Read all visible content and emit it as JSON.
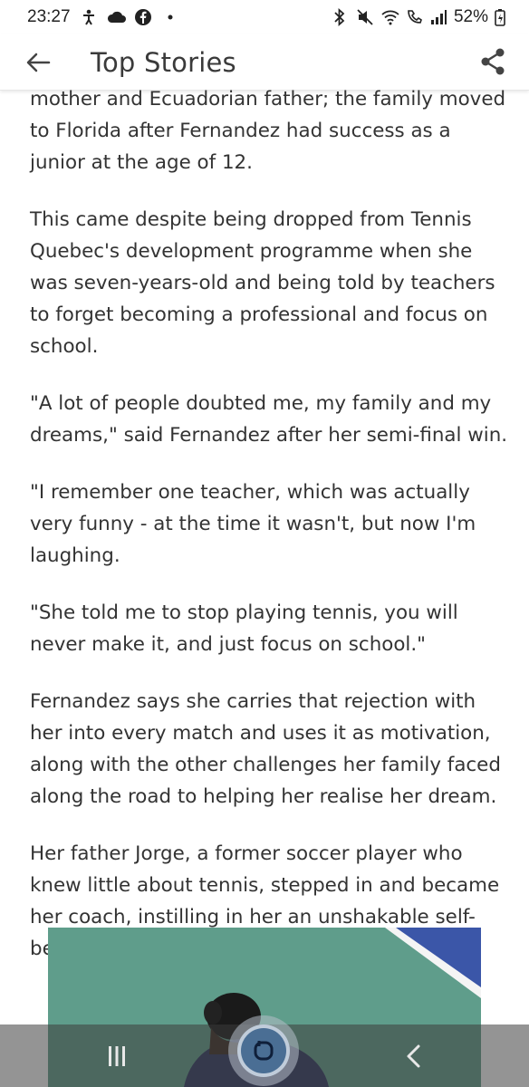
{
  "status_bar": {
    "time": "23:27",
    "battery": "52%",
    "left_icons": [
      "accessibility-icon",
      "cloud-icon",
      "facebook-icon",
      "dot-icon"
    ],
    "right_icons": [
      "bluetooth-icon",
      "mute-icon",
      "wifi-icon",
      "wifi-calling-icon",
      "signal-icon",
      "battery-icon"
    ]
  },
  "app_bar": {
    "title": "Top Stories",
    "back_icon": "arrow-left-icon",
    "share_icon": "share-icon"
  },
  "article": {
    "paragraphs": [
      "mother and Ecuadorian father; the family moved to Florida after Fernandez had success as a junior at the age of 12.",
      "This came despite being dropped from Tennis Quebec's development programme when she was seven-years-old and being told by teachers to forget becoming a professional and focus on school.",
      "\"A lot of people doubted me, my family and my dreams,\" said Fernandez after her semi-final win.",
      "\"I remember one teacher, which was actually very funny - at the time it wasn't, but now I'm laughing.",
      "\"She told me to stop playing tennis, you will never make it, and just focus on school.\"",
      "Fernandez says she carries that rejection with her into every match and uses it as motivation, along with the other challenges her family faced along the road to helping her realise her dream.",
      "Her father Jorge, a former soccer player who knew little about tennis, stepped in and became her coach, instilling in her an unshakable self-belief."
    ]
  },
  "image": {
    "court_color": "#5e9c8a",
    "corner_color": "#3b56a8"
  },
  "nav_bar": {
    "recent_icon": "recent-apps-icon",
    "home_icon": "home-icon",
    "back_icon": "nav-back-icon"
  }
}
